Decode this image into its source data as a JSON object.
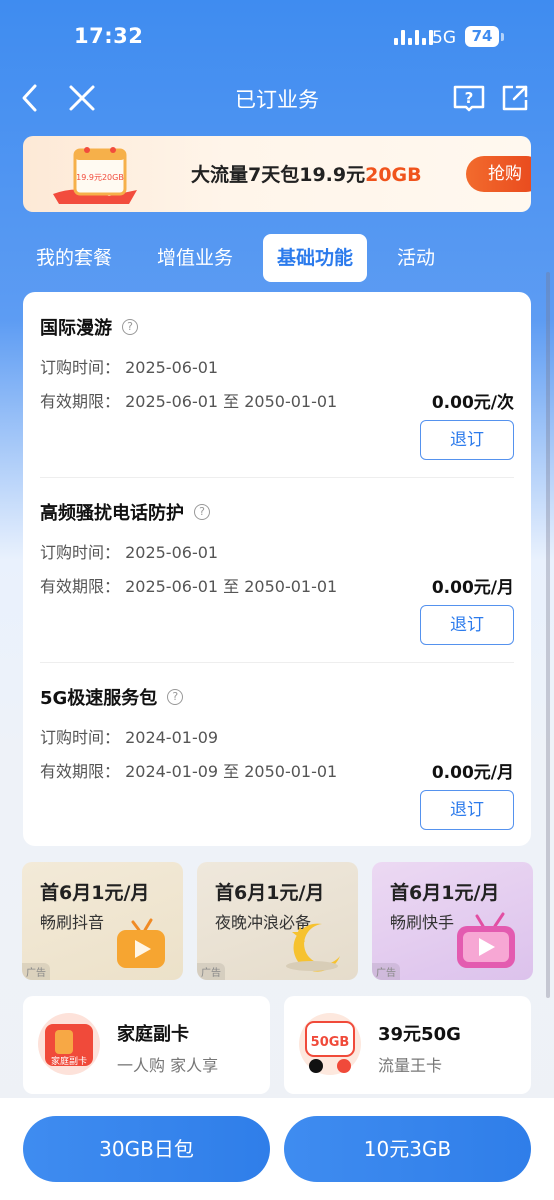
{
  "status_bar": {
    "time": "17:32",
    "network": "5G",
    "battery": "74"
  },
  "nav": {
    "title": "已订业务"
  },
  "promo": {
    "text_main": "大流量7天包19.9元",
    "text_highlight": "20GB",
    "button": "抢购",
    "calendar_label": "19.9元20GB"
  },
  "tabs": [
    {
      "label": "我的套餐",
      "active": false
    },
    {
      "label": "增值业务",
      "active": false
    },
    {
      "label": "基础功能",
      "active": true
    },
    {
      "label": "活动",
      "active": false
    }
  ],
  "services": [
    {
      "name": "国际漫游",
      "order_time": "订购时间：  2025-06-01",
      "validity": "有效期限：  2025-06-01 至 2050-01-01",
      "price": "0.00元/次",
      "button": "退订"
    },
    {
      "name": "高频骚扰电话防护",
      "order_time": "订购时间：  2025-06-01",
      "validity": "有效期限：  2025-06-01 至 2050-01-01",
      "price": "0.00元/月",
      "button": "退订"
    },
    {
      "name": "5G极速服务包",
      "order_time": "订购时间：  2024-01-09",
      "validity": "有效期限：  2024-01-09 至 2050-01-01",
      "price": "0.00元/月",
      "button": "退订"
    }
  ],
  "ads": [
    {
      "title": "首6月1元/月",
      "subtitle": "畅刷抖音",
      "tag": "广告"
    },
    {
      "title": "首6月1元/月",
      "subtitle": "夜晚冲浪必备",
      "tag": "广告"
    },
    {
      "title": "首6月1元/月",
      "subtitle": "畅刷快手",
      "tag": "广告"
    }
  ],
  "products": [
    {
      "title": "家庭副卡",
      "subtitle": "一人购 家人享",
      "img_label": "家庭副卡"
    },
    {
      "title": "39元50G",
      "subtitle": "流量王卡",
      "img_label": "50GB"
    }
  ],
  "bottom_buttons": [
    "30GB日包",
    "10元3GB"
  ],
  "colors": {
    "primary": "#3f8cf0",
    "accent_orange": "#f0531c",
    "tab_active_text": "#2c7bec"
  }
}
